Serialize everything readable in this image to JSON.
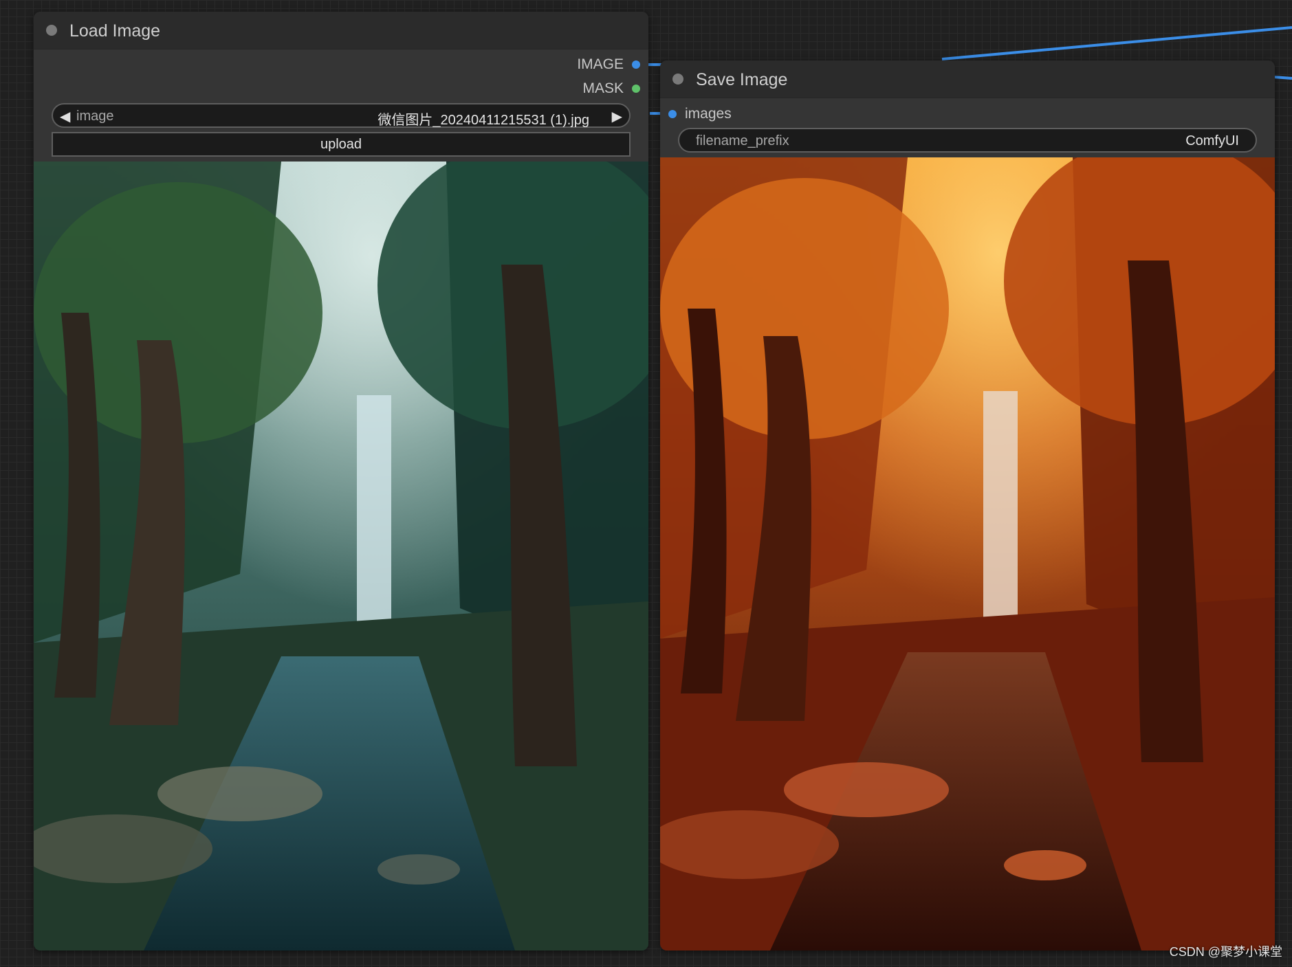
{
  "canvas": {
    "links_colors": {
      "image": "#3b8ee8"
    }
  },
  "load_node": {
    "title": "Load Image",
    "outputs": [
      {
        "label": "IMAGE",
        "color": "#3b8ee8"
      },
      {
        "label": "MASK",
        "color": "#5fc26a"
      }
    ],
    "image_widget": {
      "label": "image",
      "value": "微信图片_20240411215531 (1).jpg"
    },
    "upload_label": "upload",
    "preview": {
      "description_icon": "forest-waterfall-image"
    }
  },
  "save_node": {
    "title": "Save Image",
    "inputs": [
      {
        "label": "images",
        "color": "#3b8ee8"
      }
    ],
    "filename_prefix": {
      "label": "filename_prefix",
      "value": "ComfyUI"
    },
    "preview": {
      "description_icon": "autumn-forest-waterfall-image"
    }
  },
  "watermark": "CSDN @聚梦小课堂"
}
